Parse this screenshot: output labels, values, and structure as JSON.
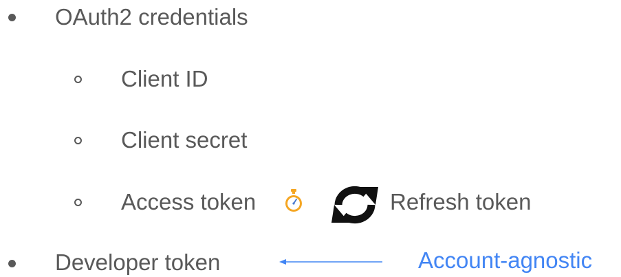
{
  "list": {
    "item_oauth": "OAuth2 credentials",
    "sub": {
      "client_id": "Client ID",
      "client_secret": "Client secret",
      "access_token": "Access token",
      "refresh_token": "Refresh token"
    },
    "item_developer": "Developer token"
  },
  "annotation": {
    "label": "Account-agnostic"
  },
  "icons": {
    "stopwatch": "stopwatch-icon",
    "refresh": "refresh-icon",
    "arrow": "arrow-left-icon"
  },
  "colors": {
    "text": "#595959",
    "accent": "#4285f4",
    "stopwatch_body": "#f5a623"
  }
}
